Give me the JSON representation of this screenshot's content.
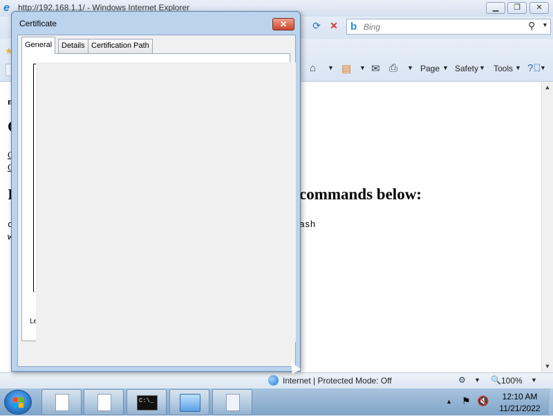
{
  "browser": {
    "window_title": "http://192.168.1.1/ - Windows Internet Explorer",
    "search_placeholder": "Bing",
    "commands": {
      "page": "Page",
      "safety": "Safety",
      "tools": "Tools"
    },
    "status": {
      "zone": "Internet | Protected Mode: Off",
      "zoom": "100%"
    },
    "page_fragments": {
      "heading_tail": "commands below:",
      "code_tail": "ash",
      "left_letters": [
        "n",
        "C",
        "C",
        "C",
        "I",
        "c",
        "w"
      ]
    }
  },
  "dialog": {
    "title": "Certificate",
    "tabs": [
      "General",
      "Details",
      "Certification Path"
    ],
    "fragment": "Le"
  },
  "taskbar": {
    "cmd_text": "C:\\_",
    "time": "12:10 AM",
    "date": "11/21/2022"
  },
  "icons": {
    "ie": "ie-icon",
    "start": "windows-logo-icon",
    "globe": "globe-icon"
  },
  "colors": {
    "close_red": "#c9452e",
    "taskbar_blue": "#7fa4c8"
  }
}
